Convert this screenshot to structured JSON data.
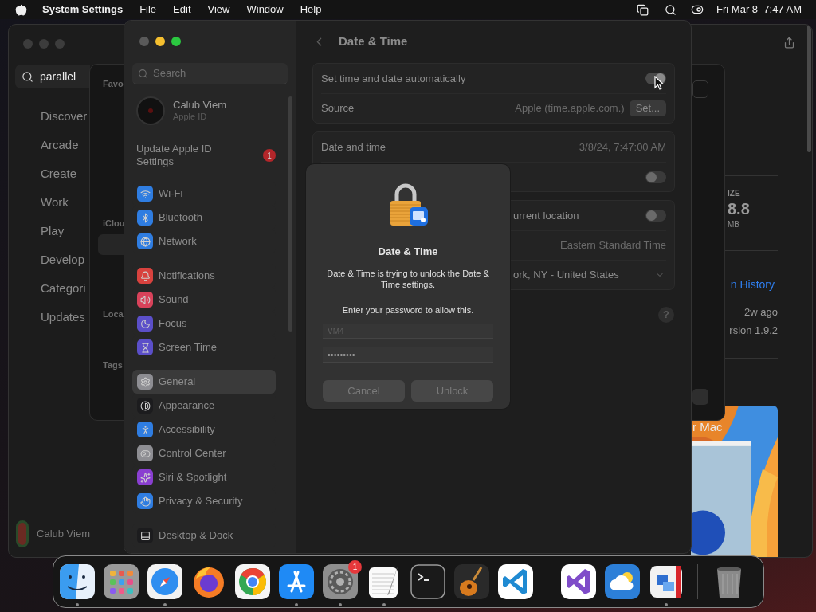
{
  "menu_bar": {
    "app_name": "System Settings",
    "menus": [
      "File",
      "Edit",
      "View",
      "Window",
      "Help"
    ],
    "clock": "Fri Mar 8  7:47 AM"
  },
  "app_store": {
    "search": {
      "value": "parallel"
    },
    "nav": [
      "Discover",
      "Arcade",
      "Create",
      "Work",
      "Play",
      "Develop",
      "Categori",
      "Updates"
    ],
    "user": "Calub Viem",
    "size_label": "IZE",
    "size_value": "8.8",
    "size_unit": "MB",
    "history_link": "n History",
    "updated": "2w ago",
    "version": "rsion 1.9.2",
    "banner_text": "r Mac"
  },
  "finder": {
    "sections": [
      "Favo",
      "iClou",
      "Loca",
      "Tags"
    ]
  },
  "settings": {
    "search": {
      "placeholder": "Search"
    },
    "account": {
      "name": "Calub Viem",
      "subtitle": "Apple ID"
    },
    "update": {
      "label": "Update Apple ID Settings",
      "badge": "1"
    },
    "groups": [
      [
        {
          "label": "Wi-Fi",
          "kind": "wifi",
          "color": "#2f7de1",
          "selected": false
        },
        {
          "label": "Bluetooth",
          "kind": "bluetooth",
          "color": "#2f7de1",
          "selected": false
        },
        {
          "label": "Network",
          "kind": "network",
          "color": "#2f7de1",
          "selected": false
        }
      ],
      [
        {
          "label": "Notifications",
          "kind": "notifications",
          "color": "#d8423e",
          "selected": false
        },
        {
          "label": "Sound",
          "kind": "sound",
          "color": "#d8425a",
          "selected": false
        },
        {
          "label": "Focus",
          "kind": "focus",
          "color": "#5b4fc9",
          "selected": false
        },
        {
          "label": "Screen Time",
          "kind": "screen_time",
          "color": "#5b4fc9",
          "selected": false
        }
      ],
      [
        {
          "label": "General",
          "kind": "general",
          "color": "#8e8e93",
          "selected": true
        },
        {
          "label": "Appearance",
          "kind": "appearance",
          "color": "#1c1c1e",
          "selected": false
        },
        {
          "label": "Accessibility",
          "kind": "accessibility",
          "color": "#2f7de1",
          "selected": false
        },
        {
          "label": "Control Center",
          "kind": "control_center",
          "color": "#8e8e93",
          "selected": false
        },
        {
          "label": "Siri & Spotlight",
          "kind": "siri",
          "color": "#8a3fd1",
          "selected": false
        },
        {
          "label": "Privacy & Security",
          "kind": "privacy",
          "color": "#2f7de1",
          "selected": false
        }
      ],
      [
        {
          "label": "Desktop & Dock",
          "kind": "dock",
          "color": "#1c1c1e",
          "selected": false
        }
      ]
    ],
    "detail": {
      "title": "Date & Time",
      "cards": [
        {
          "covered": false,
          "rows": [
            {
              "kind": "toggle",
              "label": "Set time and date automatically",
              "on": true
            },
            {
              "kind": "source",
              "label": "Source",
              "value": "Apple (time.apple.com.)",
              "button": "Set..."
            }
          ]
        },
        {
          "covered": false,
          "rows": [
            {
              "kind": "value",
              "label": "Date and time",
              "value": "3/8/24, 7:47:00 AM"
            },
            {
              "kind": "toggle",
              "on": false
            }
          ]
        },
        {
          "covered": true,
          "rows": [
            {
              "kind": "toggle",
              "label": "urrent location",
              "on": false
            },
            {
              "kind": "value",
              "value": "Eastern Standard Time"
            },
            {
              "kind": "select",
              "value": "ork, NY - United States"
            }
          ]
        }
      ],
      "help": "?"
    }
  },
  "dialog": {
    "title": "Date & Time",
    "message": "Date & Time is trying to unlock the Date & Time settings.",
    "prompt": "Enter your password to allow this.",
    "username": "VM4",
    "password": "•••••••••",
    "buttons": [
      "Cancel",
      "Unlock"
    ]
  },
  "dock": {
    "items": [
      {
        "kind": "finder",
        "running": true
      },
      {
        "kind": "launchpad",
        "running": false
      },
      {
        "kind": "safari",
        "running": true
      },
      {
        "kind": "firefox",
        "running": false
      },
      {
        "kind": "chrome",
        "running": false
      },
      {
        "kind": "appstore",
        "running": true
      },
      {
        "kind": "settings",
        "running": true,
        "badge": "1"
      },
      {
        "kind": "textedit",
        "running": true
      },
      {
        "kind": "terminal",
        "running": false
      },
      {
        "kind": "garageband",
        "running": false
      },
      {
        "kind": "vscode",
        "running": false
      },
      {
        "kind": "separator"
      },
      {
        "kind": "visualstudio",
        "running": false
      },
      {
        "kind": "weather",
        "running": false
      },
      {
        "kind": "parallels",
        "running": true
      },
      {
        "kind": "separator"
      },
      {
        "kind": "trash",
        "running": false
      }
    ]
  }
}
